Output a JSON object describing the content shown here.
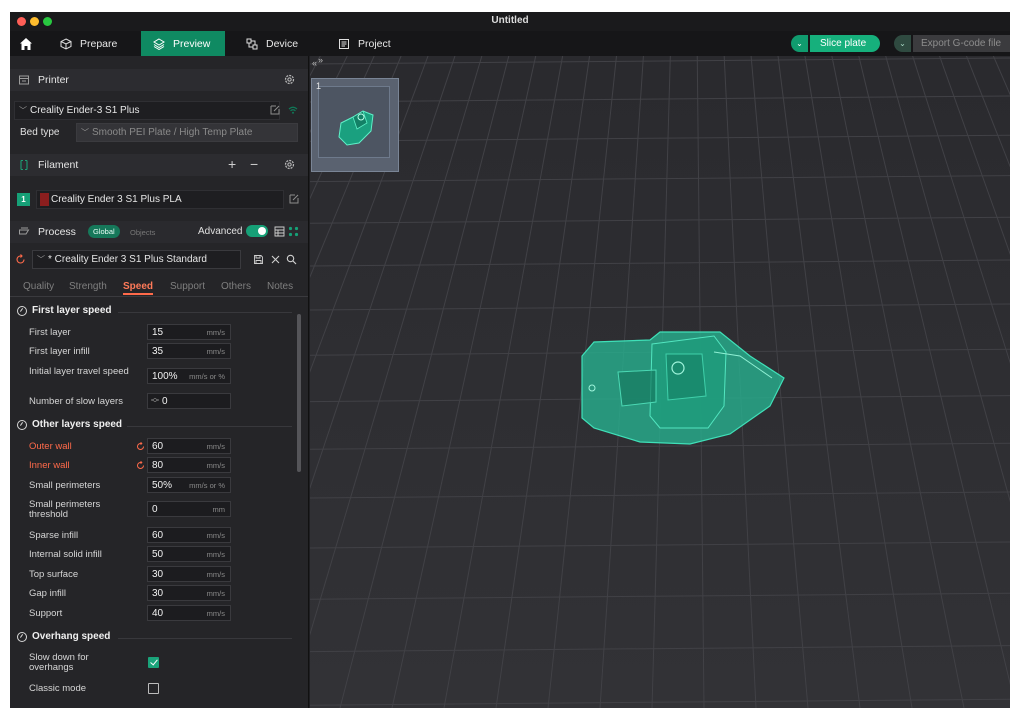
{
  "window": {
    "title": "Untitled"
  },
  "tabs": [
    {
      "label": "Prepare",
      "icon": "cube-icon"
    },
    {
      "label": "Preview",
      "icon": "layers-icon",
      "active": true
    },
    {
      "label": "Device",
      "icon": "device-icon"
    },
    {
      "label": "Project",
      "icon": "project-icon"
    }
  ],
  "toolbar": {
    "slice_label": "Slice plate",
    "export_label": "Export G-code file"
  },
  "printer": {
    "section_title": "Printer",
    "selected": "Creality Ender-3 S1 Plus",
    "bed_type_label": "Bed type",
    "bed_type_value": "Smooth PEI Plate / High Temp Plate"
  },
  "filament": {
    "section_title": "Filament",
    "slot_number": "1",
    "selected": "Creality Ender 3 S1 Plus PLA",
    "swatch_color": "#8b1e1e"
  },
  "process": {
    "section_title": "Process",
    "global_label": "Global",
    "objects_label": "Objects",
    "advanced_label": "Advanced",
    "advanced_on": true,
    "preset": "* Creality Ender 3 S1 Plus Standard"
  },
  "subtabs": [
    "Quality",
    "Strength",
    "Speed",
    "Support",
    "Others",
    "Notes"
  ],
  "active_subtab": "Speed",
  "groups": {
    "first_layer": {
      "title": "First layer speed",
      "options": [
        {
          "label": "First layer",
          "value": "15",
          "unit": "mm/s"
        },
        {
          "label": "First layer infill",
          "value": "35",
          "unit": "mm/s"
        },
        {
          "label": "Initial layer travel speed",
          "value": "100%",
          "unit": "mm/s or %"
        },
        {
          "label": "Number of slow layers",
          "value": "0",
          "unit": ""
        }
      ]
    },
    "other_layers": {
      "title": "Other layers speed",
      "options": [
        {
          "label": "Outer wall",
          "value": "60",
          "unit": "mm/s",
          "modified": true
        },
        {
          "label": "Inner wall",
          "value": "80",
          "unit": "mm/s",
          "modified": true
        },
        {
          "label": "Small perimeters",
          "value": "50%",
          "unit": "mm/s or %"
        },
        {
          "label": "Small perimeters threshold",
          "value": "0",
          "unit": "mm"
        },
        {
          "label": "Sparse infill",
          "value": "60",
          "unit": "mm/s"
        },
        {
          "label": "Internal solid infill",
          "value": "50",
          "unit": "mm/s"
        },
        {
          "label": "Top surface",
          "value": "30",
          "unit": "mm/s"
        },
        {
          "label": "Gap infill",
          "value": "30",
          "unit": "mm/s"
        },
        {
          "label": "Support",
          "value": "40",
          "unit": "mm/s"
        }
      ]
    },
    "overhang": {
      "title": "Overhang speed",
      "options": [
        {
          "label": "Slow down for overhangs",
          "checked": true
        },
        {
          "label": "Classic mode",
          "checked": false
        }
      ]
    }
  },
  "viewport": {
    "plate_number": "1",
    "model_color": "#2ec4a0"
  },
  "colors": {
    "accent": "#16b07c",
    "modified": "#ff6a4a"
  }
}
